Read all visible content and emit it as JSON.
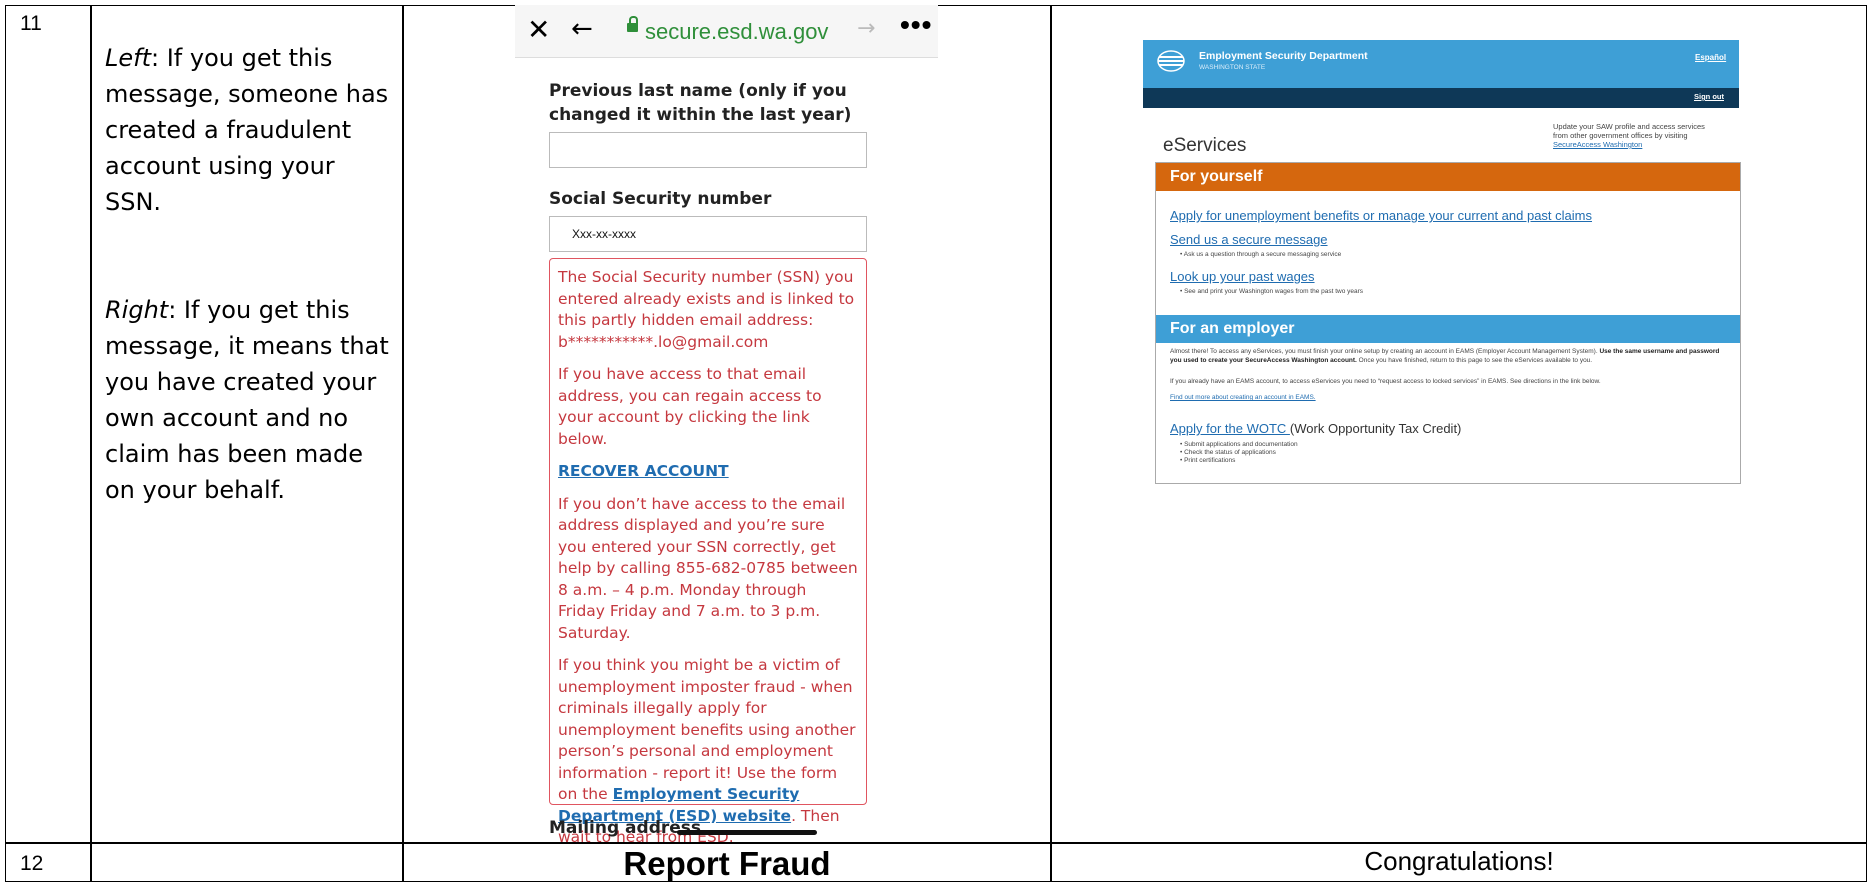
{
  "rows": [
    {
      "number": "11"
    },
    {
      "number": "12"
    }
  ],
  "description": {
    "left_label": "Left",
    "left_text": ": If you get this message, someone has created a fraudulent account using your SSN.",
    "right_label": "Right",
    "right_text": ": If you get this message, it means that you have created your own account and no claim has been made on your behalf."
  },
  "phone": {
    "url": "secure.esd.wa.gov",
    "close_icon": "close-icon",
    "back_icon": "back-arrow-icon",
    "forward_icon": "forward-arrow-icon",
    "more_icon": "more-dots-icon",
    "prev_last_name_label": "Previous last name (only if you changed it within the last year)",
    "prev_last_name_value": "",
    "ssn_label": "Social Security number",
    "ssn_value": "Xxx-xx-xxxx",
    "error": {
      "p1": "The Social Security number (SSN) you entered already exists and is linked to this partly hidden email address: b***********.lo@gmail.com",
      "p2": "If you have access to that email address, you can regain access to your account by clicking the link below.",
      "recover_link": "RECOVER ACCOUNT",
      "p3": "If you don’t have access to the email address displayed and you’re sure you entered your SSN correctly, get help by calling 855-682-0785 between 8 a.m. – 4 p.m. Monday through Friday Friday and 7 a.m. to 3 p.m. Saturday.",
      "p4_before": "If you think you might be a victim of unemployment imposter fraud - when criminals illegally apply for unemployment benefits using another person’s personal and employment information - report it! Use the form on the ",
      "p4_link": "Employment Security Department (ESD) website",
      "p4_after": ". Then wait to hear from ESD."
    },
    "mailing_label": "Mailing address"
  },
  "eservices": {
    "dept_name": "Employment Security Department",
    "state": "WASHINGTON STATE",
    "espanol": "Español",
    "signout": "Sign out",
    "title": "eServices",
    "update_line1": "Update your SAW profile and access services",
    "update_line2": "from other government offices by visiting",
    "update_link": "SecureAccess Washington",
    "for_yourself": "For yourself",
    "link_apply": "Apply for unemployment benefits or manage your current and past claims",
    "link_message": "Send us a secure message",
    "message_bullet": "Ask us a question through a secure messaging service",
    "link_wages": "Look up your past wages",
    "wages_bullet": "See and print your Washington wages from the past two years",
    "for_employer": "For an employer",
    "employer_p1_a": "Almost there! To access any eServices, you must finish your online setup by creating an account in EAMS (Employer Account Management System). ",
    "employer_p1_b": "Use the same username and password you used to create your SecureAccess Washington account.",
    "employer_p1_c": " Once you have finished, return to this page to see the eServices available to you.",
    "employer_p2": "If you already have an EAMS account, to access eServices you need to “request access to locked services” in EAMS. See directions in the link below.",
    "employer_link": "Find out more about creating an account in EAMS.",
    "wotc_link": "Apply for the WOTC ",
    "wotc_text": "(Work Opportunity Tax Credit)",
    "wotc_bullets": [
      "Submit applications and documentation",
      "Check the status of applications",
      "Print certifications"
    ]
  },
  "footer": {
    "report_fraud": "Report Fraud",
    "congratulations": "Congratulations!"
  }
}
